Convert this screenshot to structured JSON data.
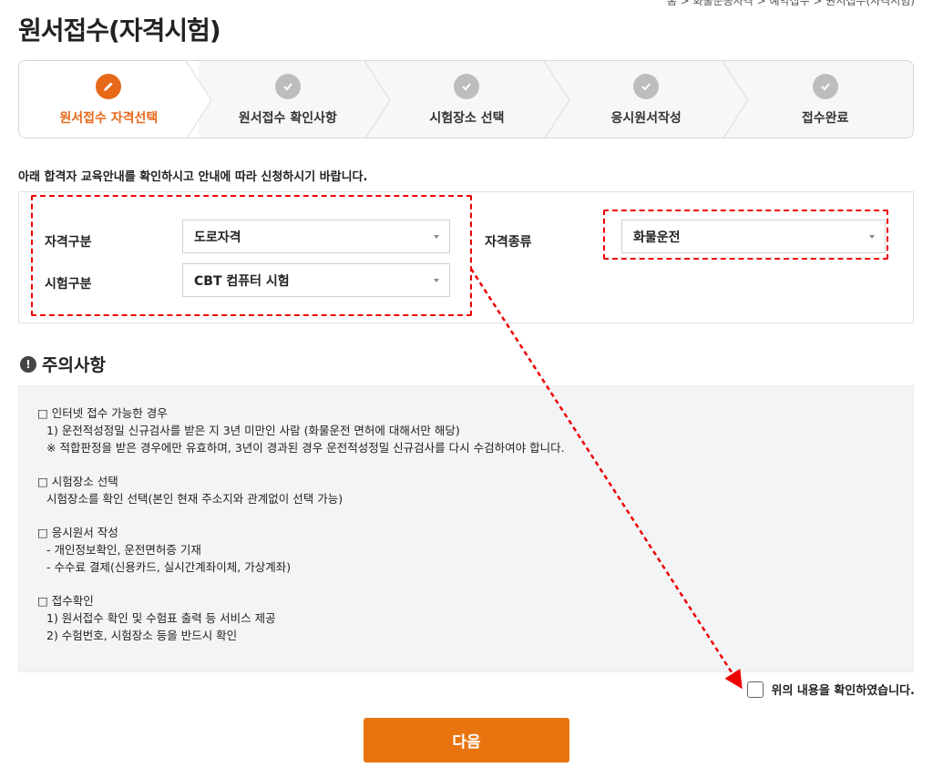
{
  "page": {
    "title": "원서접수(자격시험)",
    "breadcrumb": "홈 > 화물운송자격 > 예약접수 > 원서접수(자격시험)"
  },
  "steps": [
    {
      "label": "원서접수 자격선택",
      "state": "active",
      "icon": "pencil-icon"
    },
    {
      "label": "원서접수 확인사항",
      "state": "pending",
      "icon": "check-icon"
    },
    {
      "label": "시험장소 선택",
      "state": "pending",
      "icon": "check-icon"
    },
    {
      "label": "응시원서작성",
      "state": "pending",
      "icon": "check-icon"
    },
    {
      "label": "접수완료",
      "state": "pending",
      "icon": "check-icon"
    }
  ],
  "guide_text": "아래 합격자 교육안내를 확인하시고 안내에 따라 신청하시기 바랍니다.",
  "form": {
    "qual_type_label": "자격구분",
    "qual_type_value": "도로자격",
    "exam_type_label": "시험구분",
    "exam_type_value": "CBT 컴퓨터 시험",
    "qual_kind_label": "자격종류",
    "qual_kind_value": "화물운전"
  },
  "notice": {
    "title": "주의사항",
    "icon": "exclamation-icon",
    "sections": [
      {
        "lines": [
          "□ 인터넷 접수 가능한 경우",
          "  1) 운전적성정밀 신규검사를 받은 지 3년 미만인 사람 (화물운전 면허에 대해서만 해당)",
          "  ※ 적합판정을 받은 경우에만 유효하며, 3년이 경과된 경우 운전적성정밀 신규검사를 다시 수검하여야 합니다."
        ]
      },
      {
        "lines": [
          "□ 시험장소 선택",
          "  시험장소를 확인 선택(본인 현재 주소지와 관계없이 선택 가능)"
        ]
      },
      {
        "lines": [
          "□ 응시원서 작성",
          "  - 개인정보확인, 운전면허증 기재",
          "  - 수수료 결제(신용카드, 실시간계좌이체, 가상계좌)"
        ]
      },
      {
        "lines": [
          "□ 접수확인",
          "  1) 원서접수 확인 및 수험표 출력 등 서비스 제공",
          "  2) 수험번호, 시험장소 등을 반드시 확인"
        ]
      }
    ]
  },
  "confirm": {
    "label": "위의 내용을 확인하였습니다.",
    "checked": false
  },
  "next_button": "다음",
  "colors": {
    "accent": "#e8740f",
    "active_step": "#e8681a",
    "annotation": "#e00000"
  }
}
